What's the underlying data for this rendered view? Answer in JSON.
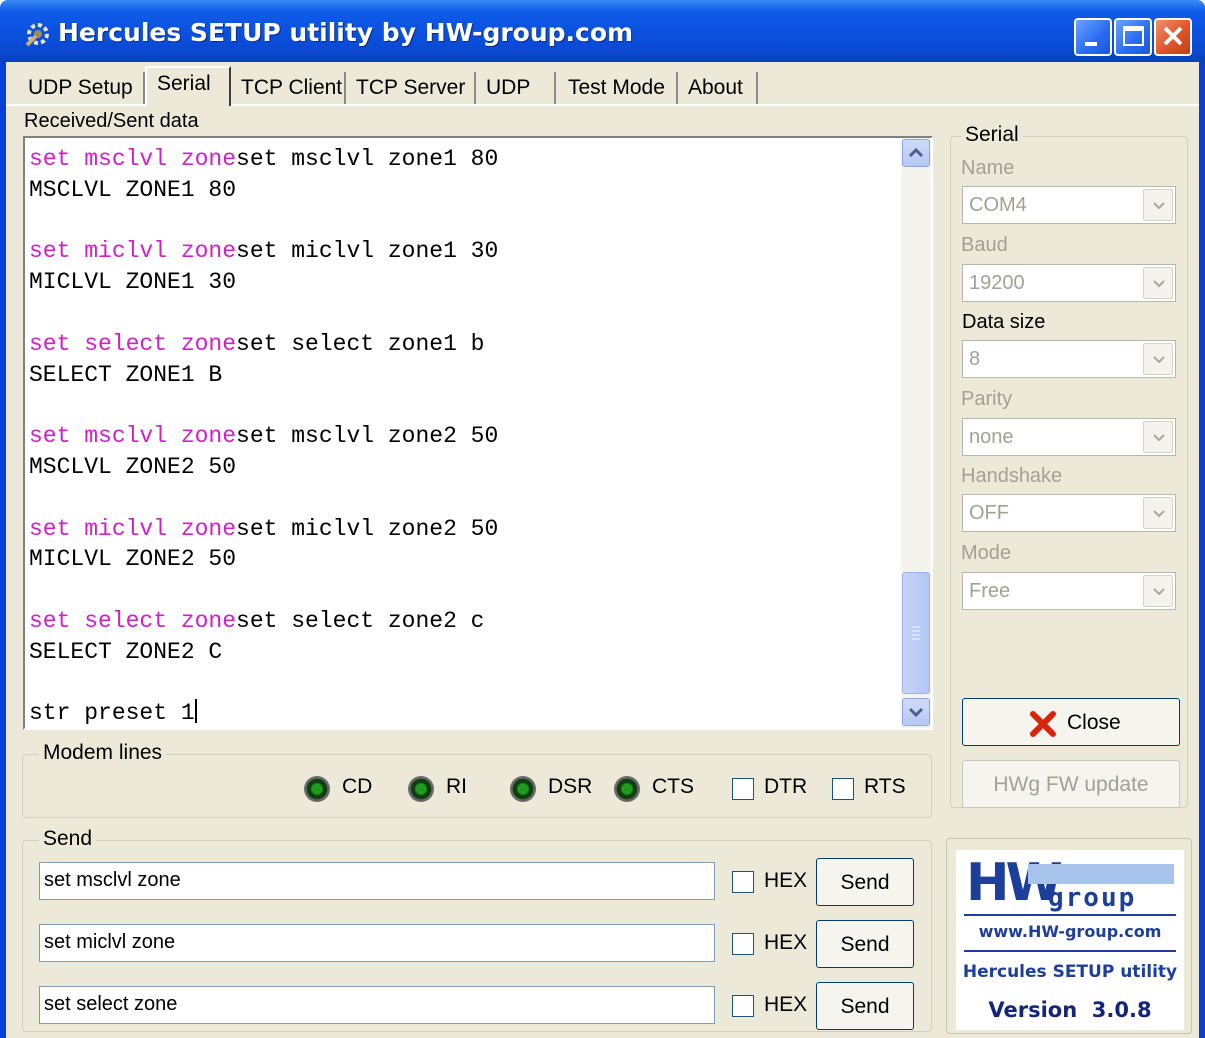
{
  "window": {
    "title": "Hercules SETUP utility by HW-group.com"
  },
  "tabs": [
    {
      "label": "UDP Setup"
    },
    {
      "label": "Serial"
    },
    {
      "label": "TCP Client"
    },
    {
      "label": "TCP Server"
    },
    {
      "label": "UDP"
    },
    {
      "label": "Test Mode"
    },
    {
      "label": "About"
    }
  ],
  "active_tab": "Serial",
  "terminal": {
    "label": "Received/Sent data",
    "lines": [
      {
        "sent": "set msclvl zone",
        "recv": "set msclvl zone1 80"
      },
      {
        "sent": "",
        "recv": "MSCLVL ZONE1 80"
      },
      {
        "sent": "",
        "recv": ""
      },
      {
        "sent": "set miclvl zone",
        "recv": "set miclvl zone1 30"
      },
      {
        "sent": "",
        "recv": "MICLVL ZONE1 30"
      },
      {
        "sent": "",
        "recv": ""
      },
      {
        "sent": "set select zone",
        "recv": "set select zone1 b"
      },
      {
        "sent": "",
        "recv": "SELECT ZONE1 B"
      },
      {
        "sent": "",
        "recv": ""
      },
      {
        "sent": "set msclvl zone",
        "recv": "set msclvl zone2 50"
      },
      {
        "sent": "",
        "recv": "MSCLVL ZONE2 50"
      },
      {
        "sent": "",
        "recv": ""
      },
      {
        "sent": "set miclvl zone",
        "recv": "set miclvl zone2 50"
      },
      {
        "sent": "",
        "recv": "MICLVL ZONE2 50"
      },
      {
        "sent": "",
        "recv": ""
      },
      {
        "sent": "set select zone",
        "recv": "set select zone2 c"
      },
      {
        "sent": "",
        "recv": "SELECT ZONE2 C"
      },
      {
        "sent": "",
        "recv": ""
      },
      {
        "sent": "",
        "recv": "str preset 1"
      }
    ]
  },
  "modem_lines": {
    "title": "Modem lines",
    "cd": "CD",
    "ri": "RI",
    "dsr": "DSR",
    "cts": "CTS",
    "dtr": "DTR",
    "rts": "RTS"
  },
  "serial": {
    "title": "Serial",
    "name_label": "Name",
    "name_value": "COM4",
    "baud_label": "Baud",
    "baud_value": "19200",
    "datasize_label": "Data size",
    "datasize_value": "8",
    "parity_label": "Parity",
    "parity_value": "none",
    "handshake_label": "Handshake",
    "handshake_value": "OFF",
    "mode_label": "Mode",
    "mode_value": "Free"
  },
  "buttons": {
    "close": "Close",
    "fw_update": "HWg FW update"
  },
  "send": {
    "title": "Send",
    "rows": [
      {
        "value": "set msclvl zone",
        "hex_label": "HEX",
        "button": "Send"
      },
      {
        "value": "set miclvl zone",
        "hex_label": "HEX",
        "button": "Send"
      },
      {
        "value": "set select zone",
        "hex_label": "HEX",
        "button": "Send"
      }
    ]
  },
  "logo": {
    "brand": "HW",
    "group": "group",
    "url": "www.HW-group.com",
    "product": "Hercules SETUP utility",
    "version": "Version  3.0.8"
  },
  "colors": {
    "title_bar": "#0a4fdc",
    "face": "#ece9d8",
    "sent_text": "#d020c8",
    "logo_blue": "#1d3f9b"
  }
}
